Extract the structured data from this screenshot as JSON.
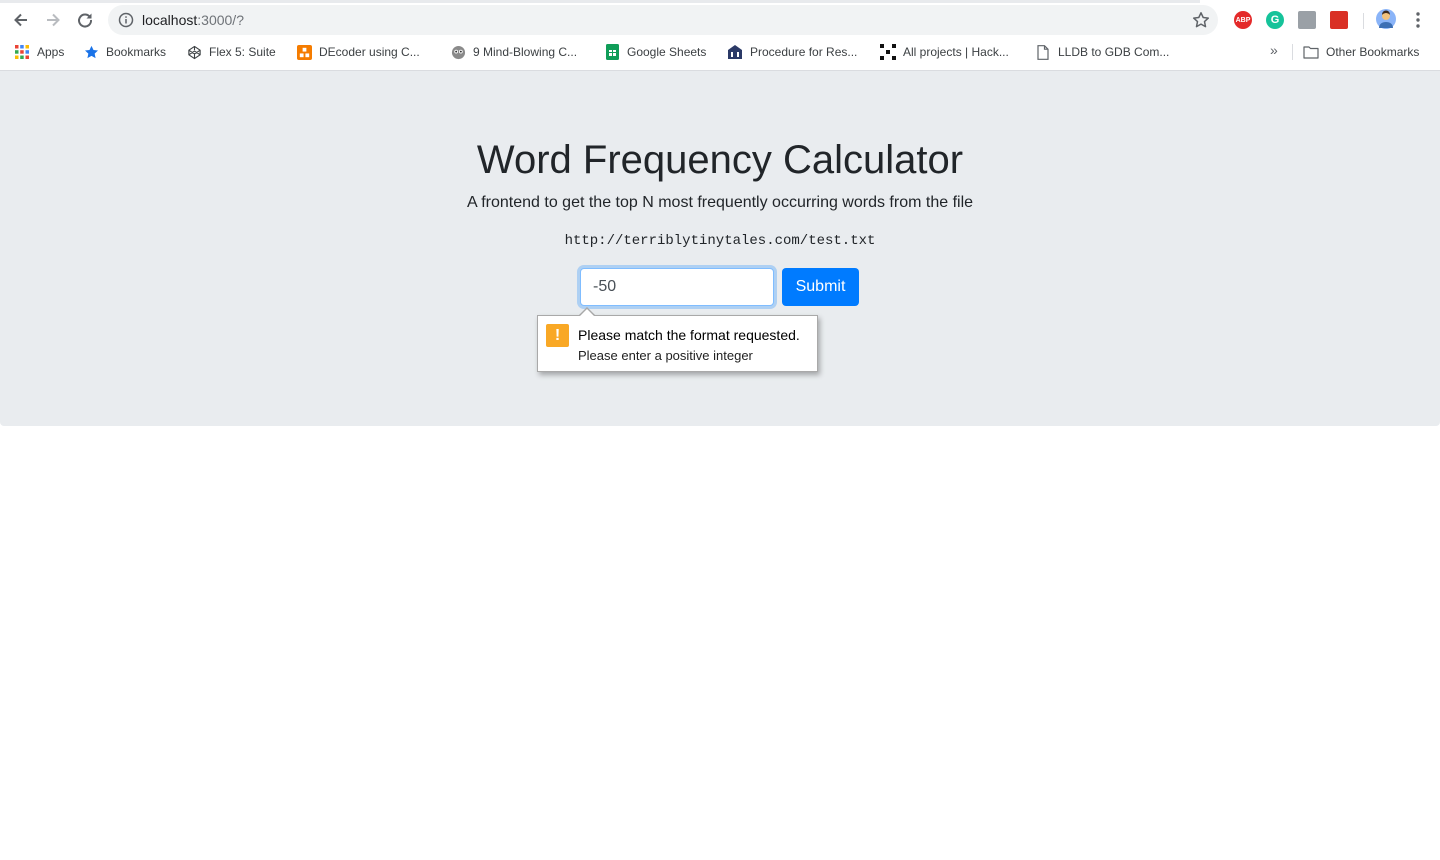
{
  "browser": {
    "url_host": "localhost",
    "url_rest": ":3000/?",
    "extensions": [
      {
        "name": "adblock-plus",
        "label": "ABP",
        "color": "#e42a2a"
      },
      {
        "name": "grammarly",
        "label": "G",
        "color": "#15c39a"
      },
      {
        "name": "extension-gray",
        "label": "",
        "color": "#9aa0a6"
      },
      {
        "name": "extension-red",
        "label": "",
        "color": "#d93025"
      }
    ]
  },
  "bookmarks": [
    {
      "name": "apps",
      "label": "Apps",
      "icon": "apps-grid-icon"
    },
    {
      "name": "bookmarks",
      "label": "Bookmarks",
      "icon": "star-icon"
    },
    {
      "name": "flex-suite",
      "label": "Flex 5: Suite",
      "icon": "codepen-icon"
    },
    {
      "name": "decoder",
      "label": "DEcoder using C...",
      "icon": "orange-app-icon"
    },
    {
      "name": "mind-blowing",
      "label": "9 Mind-Blowing C...",
      "icon": "owl-icon"
    },
    {
      "name": "google-sheets",
      "label": "Google Sheets",
      "icon": "sheets-icon"
    },
    {
      "name": "procedure",
      "label": "Procedure for Res...",
      "icon": "building-icon"
    },
    {
      "name": "hackathon",
      "label": "All projects | Hack...",
      "icon": "hack-icon"
    },
    {
      "name": "lldb",
      "label": "LLDB to GDB Com...",
      "icon": "page-icon"
    }
  ],
  "other_bookmarks": "Other Bookmarks",
  "more_bookmarks": "»",
  "main": {
    "title": "Word Frequency Calculator",
    "subtitle": "A frontend to get the top N most frequently occurring words from the file",
    "file_url": "http://terriblytinytales.com/test.txt",
    "input_value": "-50",
    "submit_label": "Submit"
  },
  "validation": {
    "icon": "warning-icon",
    "message": "Please match the format requested.",
    "hint": "Please enter a positive integer"
  }
}
